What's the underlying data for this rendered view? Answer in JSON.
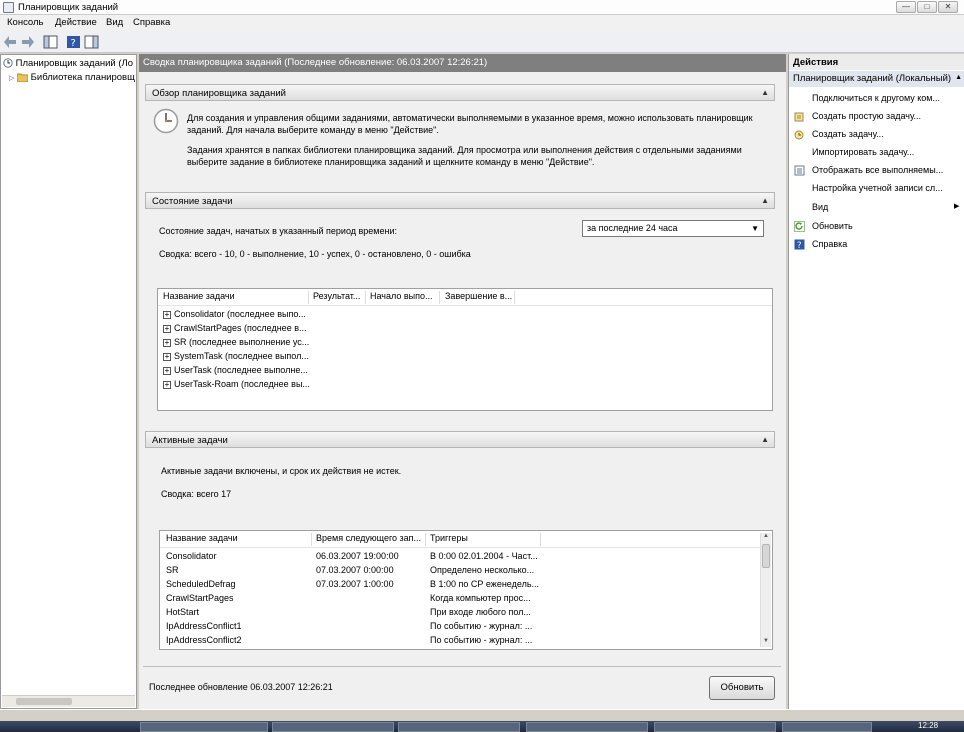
{
  "window": {
    "title": "Планировщик заданий",
    "min": "—",
    "max": "□",
    "close": "✕"
  },
  "menu": [
    "Консоль",
    "Действие",
    "Вид",
    "Справка"
  ],
  "tree": {
    "root": "Планировщик заданий (Ло",
    "child": "Библиотека планировщ"
  },
  "center": {
    "header": "Сводка планировщика заданий (Последнее обновление: 06.03.2007 12:26:21)",
    "overview": {
      "title": "Обзор планировщика заданий",
      "p1": "Для создания и управления общими заданиями, автоматически выполняемыми в указанное время, можно использовать планировщик заданий. Для начала выберите команду в меню \"Действие\".",
      "p2": "Задания хранятся в папках библиотеки планировщика заданий. Для просмотра или выполнения действия с отдельными заданиями выберите задание в библиотеке планировщика заданий и щелкните команду в меню \"Действие\"."
    },
    "status": {
      "title": "Состояние задачи",
      "period_label": "Состояние задач, начатых в указанный период времени:",
      "period_value": "за последние 24 часа",
      "summary": "Сводка: всего - 10, 0 - выполнение, 10 - успех, 0 - остановлено, 0 - ошибка",
      "columns": [
        "Название задачи",
        "Результат...",
        "Начало выпо...",
        "Завершение в..."
      ],
      "rows": [
        "Consolidator (последнее выпо...",
        "CrawlStartPages (последнее в...",
        "SR (последнее выполнение ус...",
        "SystemTask (последнее выпол...",
        "UserTask (последнее выполне...",
        "UserTask-Roam (последнее вы..."
      ]
    },
    "active": {
      "title": "Активные задачи",
      "note": "Активные задачи включены, и срок их действия не истек.",
      "summary": "Сводка: всего 17",
      "columns": [
        "Название задачи",
        "Время следующего зап...",
        "Триггеры"
      ],
      "rows": [
        {
          "name": "Consolidator",
          "next": "06.03.2007 19:00:00",
          "trigger": "В 0:00 02.01.2004 - Част..."
        },
        {
          "name": "SR",
          "next": "07.03.2007 0:00:00",
          "trigger": "Определено несколько..."
        },
        {
          "name": "ScheduledDefrag",
          "next": "07.03.2007 1:00:00",
          "trigger": "В 1:00 по СР еженедель..."
        },
        {
          "name": "CrawlStartPages",
          "next": "",
          "trigger": "Когда компьютер прос..."
        },
        {
          "name": "HotStart",
          "next": "",
          "trigger": "При входе любого пол..."
        },
        {
          "name": "IpAddressConflict1",
          "next": "",
          "trigger": "По событию - журнал: ..."
        },
        {
          "name": "IpAddressConflict2",
          "next": "",
          "trigger": "По событию - журнал: ..."
        }
      ]
    },
    "footer": {
      "last_update": "Последнее обновление 06.03.2007 12:26:21",
      "refresh_button": "Обновить"
    }
  },
  "actions": {
    "header": "Действия",
    "group": "Планировщик заданий (Локальный)",
    "items": [
      {
        "label": "Подключиться к другому ком...",
        "icon": "none"
      },
      {
        "label": "Создать простую задачу...",
        "icon": "wizard-icon"
      },
      {
        "label": "Создать задачу...",
        "icon": "new-task-icon"
      },
      {
        "label": "Импортировать задачу...",
        "icon": "none"
      },
      {
        "label": "Отображать все выполняемы...",
        "icon": "list-icon"
      },
      {
        "label": "Настройка учетной записи сл...",
        "icon": "none"
      },
      {
        "label": "Вид",
        "icon": "none"
      },
      {
        "label": "Обновить",
        "icon": "refresh-icon"
      },
      {
        "label": "Справка",
        "icon": "help-icon"
      }
    ]
  },
  "taskbar": {
    "clock": "12:28"
  }
}
